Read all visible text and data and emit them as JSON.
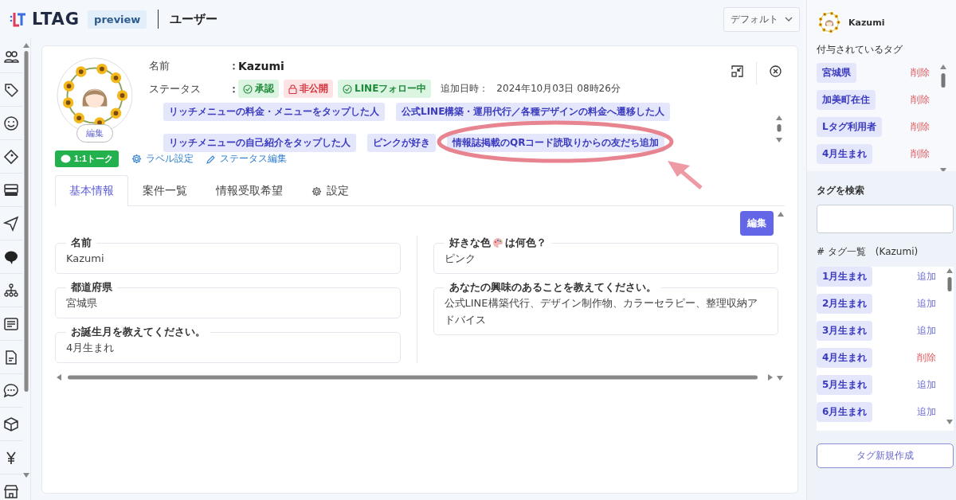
{
  "header": {
    "logo": "LTAG",
    "badge": "preview",
    "title": "ユーザー",
    "view_select": "デフォルト"
  },
  "profile": {
    "avatar_edit": "編集",
    "rows": [
      {
        "label": "名前",
        "colon": "：",
        "value": "Kazumi"
      },
      {
        "label": "ステータス",
        "colon": "："
      }
    ],
    "statuses": [
      {
        "kind": "approved",
        "label": "承認"
      },
      {
        "kind": "private",
        "label": "非公開"
      },
      {
        "kind": "follow",
        "label": "LINEフォロー中"
      }
    ],
    "added_label": "追加日時：",
    "added_value": "2024年10月03日 08時26分",
    "tags": [
      "リッチメニューの料金・メニューをタップした人",
      "公式LINE構築・運用代行／各種デザインの料金へ遷移した人",
      "リッチメニューの自己紹介をタップした人",
      "ピンクが好き",
      "情報誌掲載のQRコード読取りからの友だち追加"
    ],
    "actions": [
      {
        "kind": "talk",
        "label": "1:1トーク"
      },
      {
        "kind": "label",
        "label": "ラベル設定"
      },
      {
        "kind": "status",
        "label": "ステータス編集"
      }
    ]
  },
  "tabs": [
    {
      "label": "基本情報",
      "selected": true
    },
    {
      "label": "案件一覧",
      "selected": false
    },
    {
      "label": "情報受取希望",
      "selected": false
    },
    {
      "label": "設定",
      "selected": false,
      "kind": "settings"
    }
  ],
  "edit_button": "編集",
  "fields_left": [
    {
      "label": "名前",
      "value": "Kazumi"
    },
    {
      "label": "都道府県",
      "value": "宮城県"
    },
    {
      "label": "お誕生月を教えてください。",
      "value": "4月生まれ"
    }
  ],
  "fields_right": [
    {
      "label": "好きな色",
      "label_after": "は何色？",
      "kind": "palette",
      "value": "ピンク"
    },
    {
      "label": "あなたの興味のあることを教えてください。",
      "value": "公式LINE構築代行、デザイン制作物、カラーセラピー、整理収納アドバイス"
    }
  ],
  "side": {
    "user_name": "Kazumi",
    "assigned_title": "付与されているタグ",
    "assigned_tags": [
      {
        "label": "宮城県",
        "action": "削除"
      },
      {
        "label": "加美町在住",
        "action": "削除"
      },
      {
        "label": "Lタグ利用者",
        "action": "削除"
      },
      {
        "label": "4月生まれ",
        "action": "削除"
      }
    ],
    "search_label": "タグを検索",
    "list_title": "# タグ一覧　(Kazumi)",
    "tag_list": [
      {
        "label": "1月生まれ",
        "action": "追加",
        "assigned": false
      },
      {
        "label": "2月生まれ",
        "action": "追加",
        "assigned": false
      },
      {
        "label": "3月生まれ",
        "action": "追加",
        "assigned": false
      },
      {
        "label": "4月生まれ",
        "action": "削除",
        "assigned": true
      },
      {
        "label": "5月生まれ",
        "action": "追加",
        "assigned": false
      },
      {
        "label": "6月生まれ",
        "action": "追加",
        "assigned": false
      }
    ],
    "new_tag_button": "タグ新規作成"
  }
}
